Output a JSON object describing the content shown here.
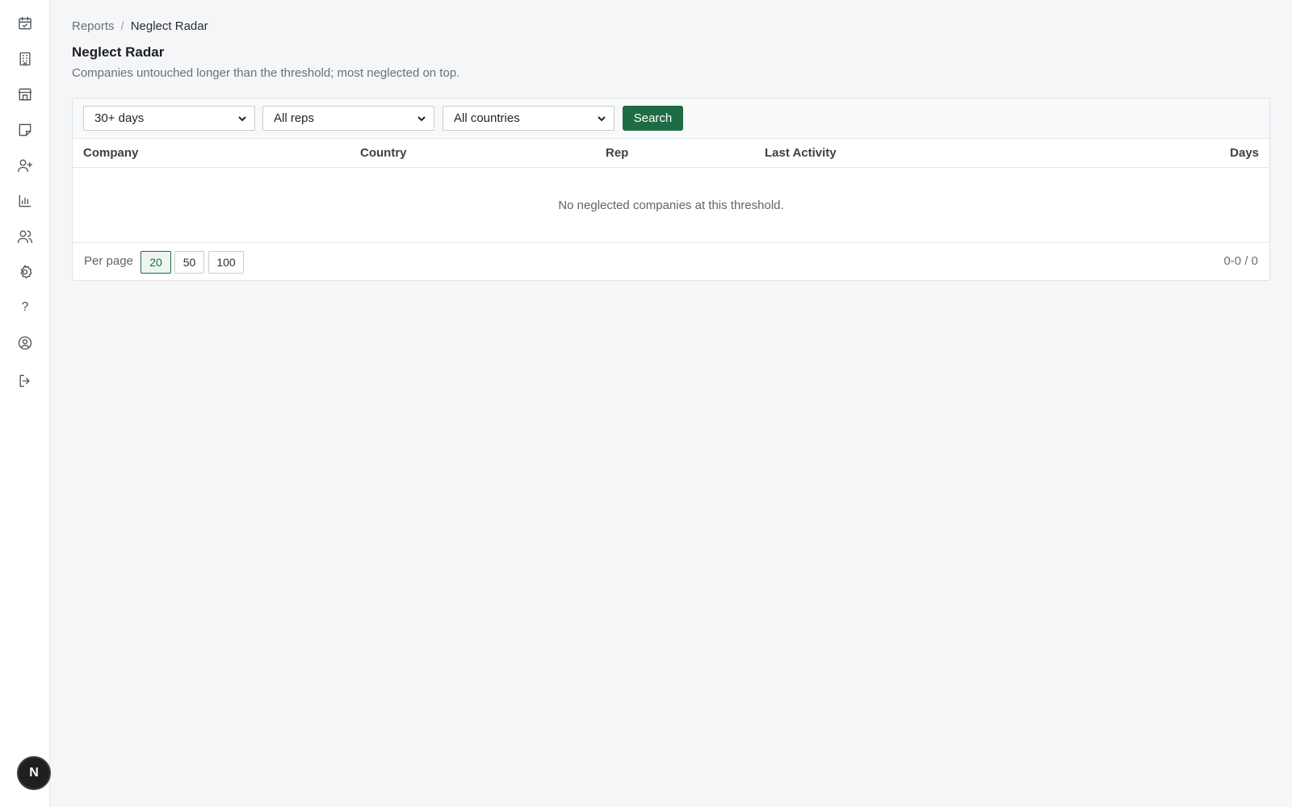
{
  "sidebar": {
    "items": [
      {
        "icon": "calendar-check-icon"
      },
      {
        "icon": "building-icon"
      },
      {
        "icon": "store-icon"
      },
      {
        "icon": "sticky-note-icon"
      },
      {
        "icon": "user-plus-icon"
      },
      {
        "icon": "bar-chart-icon"
      },
      {
        "icon": "users-icon"
      },
      {
        "icon": "gear-icon"
      },
      {
        "icon": "help-icon",
        "glyph": "?"
      },
      {
        "icon": "user-circle-icon"
      },
      {
        "icon": "logout-icon"
      }
    ],
    "user_initial": "N"
  },
  "breadcrumb": {
    "parent": "Reports",
    "separator": "/",
    "current": "Neglect Radar"
  },
  "page": {
    "title": "Neglect Radar",
    "subtitle": "Companies untouched longer than the threshold; most neglected on top."
  },
  "filters": {
    "threshold": "30+ days",
    "rep": "All reps",
    "country": "All countries",
    "search_label": "Search"
  },
  "table": {
    "columns": [
      "Company",
      "Country",
      "Rep",
      "Last Activity",
      "Days"
    ],
    "empty_message": "No neglected companies at this threshold."
  },
  "pagination": {
    "per_page_label": "Per page",
    "options": [
      "20",
      "50",
      "100"
    ],
    "selected": "20",
    "range": "0-0 / 0"
  },
  "colors": {
    "accent": "#1e6b44",
    "background": "#f5f6f8"
  }
}
